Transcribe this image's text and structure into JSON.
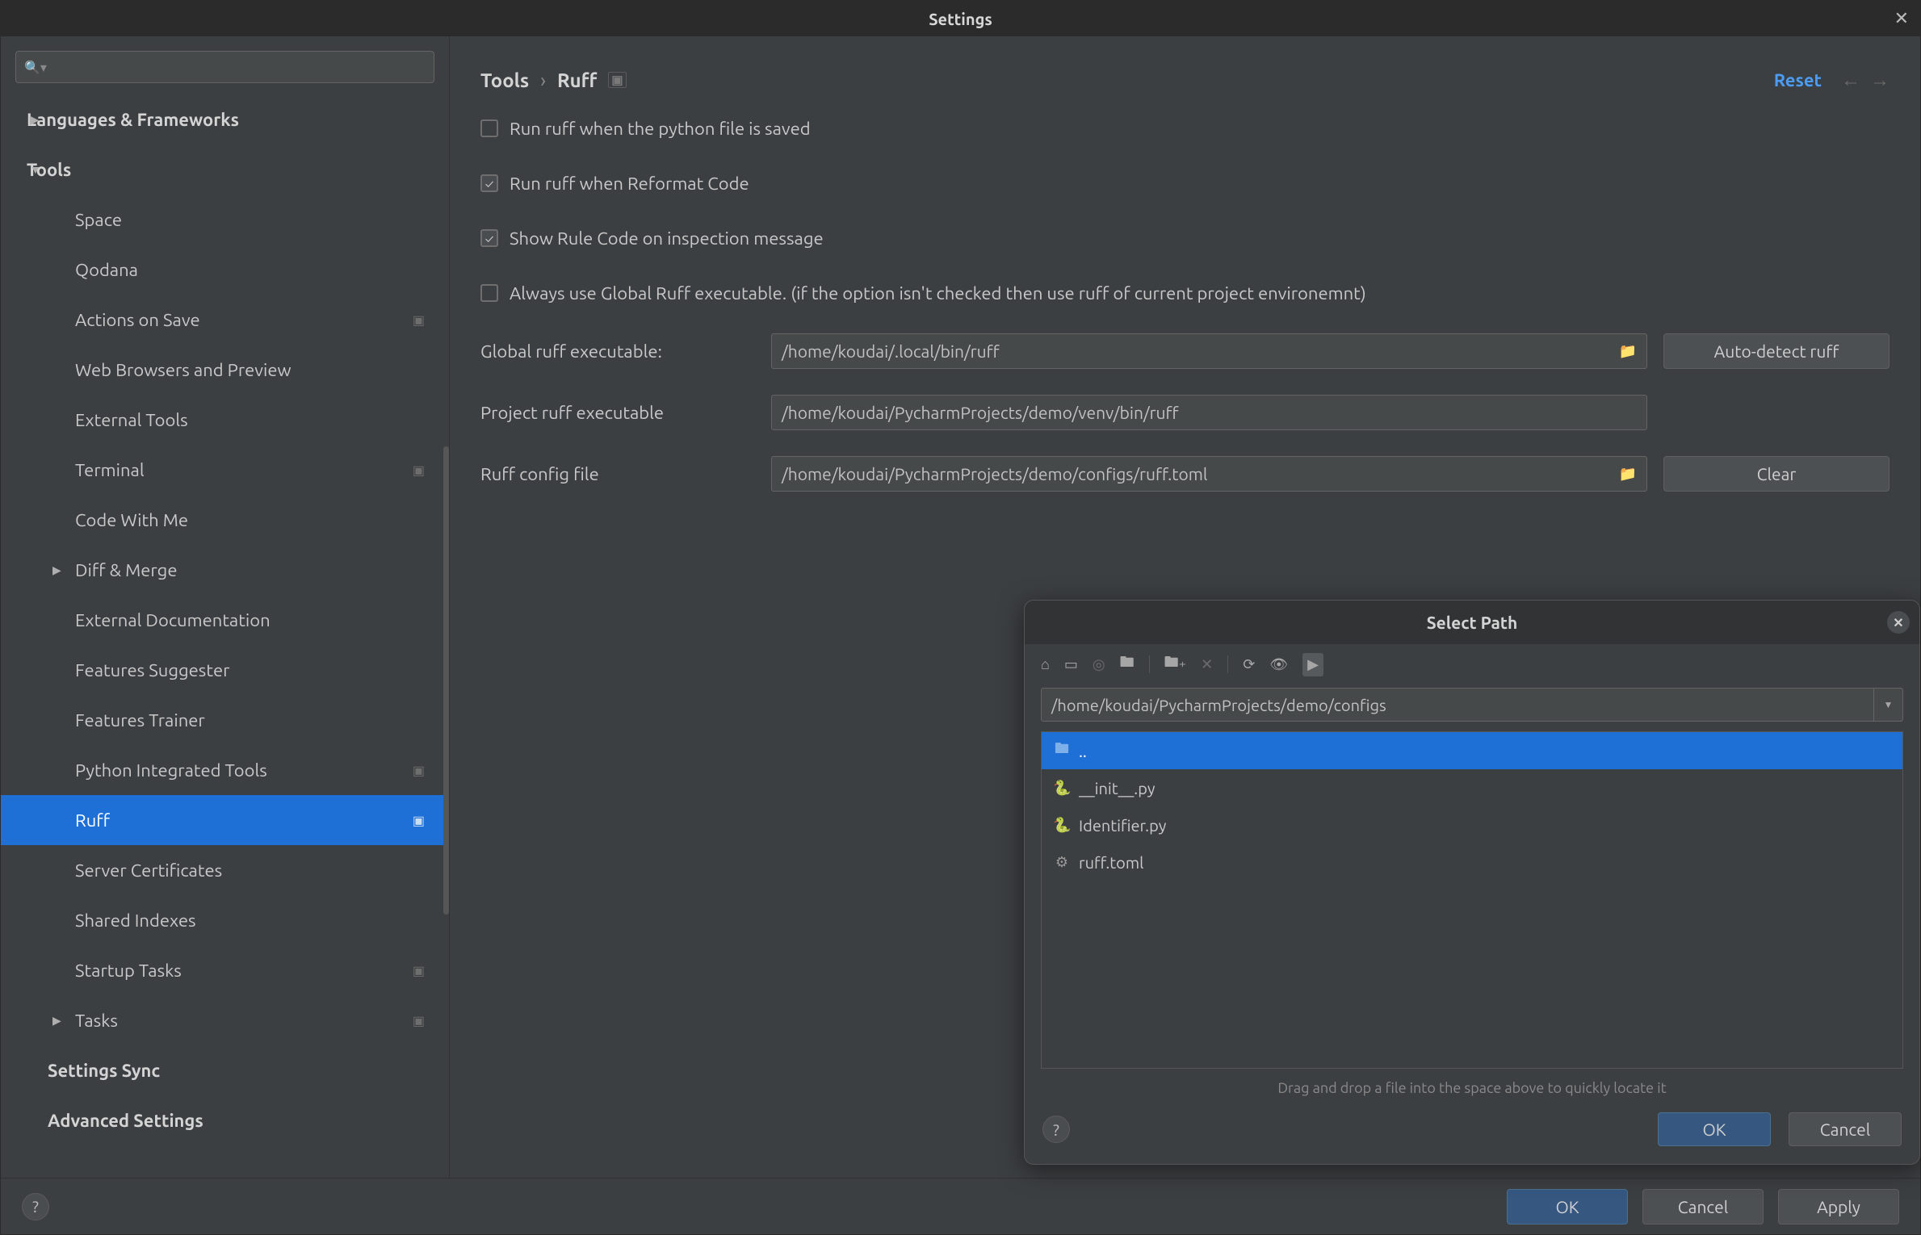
{
  "window": {
    "title": "Settings"
  },
  "sidebar": {
    "search_placeholder": "",
    "items": [
      {
        "label": "Languages & Frameworks",
        "type": "parent",
        "expanded": false
      },
      {
        "label": "Tools",
        "type": "parent",
        "expanded": true
      },
      {
        "label": "Space"
      },
      {
        "label": "Qodana"
      },
      {
        "label": "Actions on Save",
        "gear": true
      },
      {
        "label": "Web Browsers and Preview"
      },
      {
        "label": "External Tools"
      },
      {
        "label": "Terminal",
        "gear": true
      },
      {
        "label": "Code With Me"
      },
      {
        "label": "Diff & Merge",
        "type": "subparent",
        "expanded": false
      },
      {
        "label": "External Documentation"
      },
      {
        "label": "Features Suggester"
      },
      {
        "label": "Features Trainer"
      },
      {
        "label": "Python Integrated Tools",
        "gear": true
      },
      {
        "label": "Ruff",
        "gear": true,
        "selected": true
      },
      {
        "label": "Server Certificates"
      },
      {
        "label": "Shared Indexes"
      },
      {
        "label": "Startup Tasks",
        "gear": true
      },
      {
        "label": "Tasks",
        "type": "subparent",
        "expanded": false,
        "gear": true
      },
      {
        "label": "Settings Sync",
        "type": "top"
      },
      {
        "label": "Advanced Settings",
        "type": "top"
      }
    ]
  },
  "breadcrumb": {
    "root": "Tools",
    "leaf": "Ruff"
  },
  "actions": {
    "reset": "Reset"
  },
  "checkboxes": {
    "on_save": {
      "label": "Run ruff when the python file is saved",
      "checked": false
    },
    "on_reformat": {
      "label": "Run ruff when Reformat Code",
      "checked": true
    },
    "show_code": {
      "label": "Show Rule Code on inspection message",
      "checked": true
    },
    "always_global": {
      "label": "Always use Global Ruff executable. (if the option isn't checked then use ruff of current project environemnt)",
      "checked": false
    }
  },
  "fields": {
    "global_exec": {
      "label": "Global ruff executable:",
      "value": "/home/koudai/.local/bin/ruff",
      "browse": true,
      "side_btn": "Auto-detect ruff"
    },
    "project_exec": {
      "label": "Project ruff executable",
      "value": "/home/koudai/PycharmProjects/demo/venv/bin/ruff",
      "browse": false,
      "side_btn": ""
    },
    "config_file": {
      "label": "Ruff config file",
      "value": "/home/koudai/PycharmProjects/demo/configs/ruff.toml",
      "browse": true,
      "side_btn": "Clear"
    }
  },
  "dialog": {
    "title": "Select Path",
    "path": "/home/koudai/PycharmProjects/demo/configs",
    "files": [
      {
        "name": "..",
        "icon": "folder",
        "selected": true
      },
      {
        "name": "__init__.py",
        "icon": "py"
      },
      {
        "name": "Identifier.py",
        "icon": "py"
      },
      {
        "name": "ruff.toml",
        "icon": "toml"
      }
    ],
    "hint": "Drag and drop a file into the space above to quickly locate it",
    "buttons": {
      "ok": "OK",
      "cancel": "Cancel"
    }
  },
  "footer": {
    "ok": "OK",
    "cancel": "Cancel",
    "apply": "Apply"
  }
}
